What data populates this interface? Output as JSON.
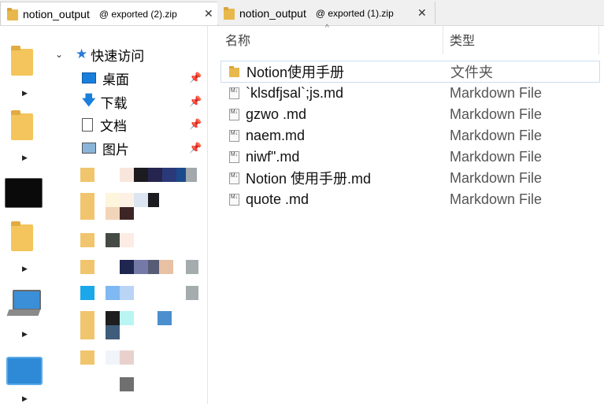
{
  "tabs": [
    {
      "title": "notion_output",
      "subtitle": "@ exported (2).zip",
      "close": "✕",
      "active": true
    },
    {
      "title": "notion_output",
      "subtitle": "@ exported (1).zip",
      "close": "✕",
      "active": false
    }
  ],
  "quick_access": {
    "label": "快速访问",
    "items": [
      {
        "label": "桌面"
      },
      {
        "label": "下载"
      },
      {
        "label": "文档"
      },
      {
        "label": "图片"
      }
    ]
  },
  "columns": {
    "name": "名称",
    "type": "类型"
  },
  "files": [
    {
      "name": "Notion使用手册",
      "type": "文件夹",
      "icon": "folder-icon"
    },
    {
      "name": "`klsdfjsal`;js.md",
      "type": "Markdown File",
      "icon": "markdown-file-icon"
    },
    {
      "name": "gzwo .md",
      "type": "Markdown File",
      "icon": "markdown-file-icon"
    },
    {
      "name": "naem.md",
      "type": "Markdown File",
      "icon": "markdown-file-icon"
    },
    {
      "name": "niwf\".md",
      "type": "Markdown File",
      "icon": "markdown-file-icon"
    },
    {
      "name": "Notion 使用手册.md",
      "type": "Markdown File",
      "icon": "markdown-file-icon"
    },
    {
      "name": "quote .md",
      "type": "Markdown File",
      "icon": "markdown-file-icon"
    }
  ],
  "colors": {
    "accent": "#1a7fdc",
    "folder": "#e8b84c"
  }
}
